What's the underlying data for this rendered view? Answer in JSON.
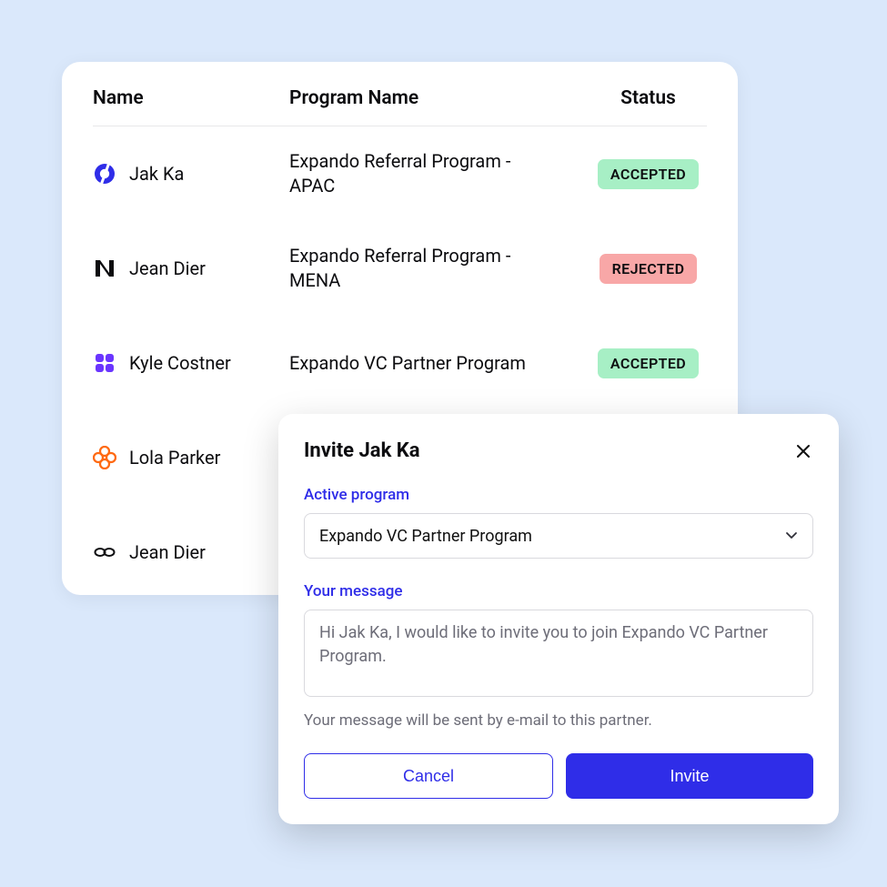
{
  "table": {
    "headers": {
      "name": "Name",
      "program": "Program Name",
      "status": "Status"
    },
    "rows": [
      {
        "icon": "circle-icon",
        "name": "Jak Ka",
        "program": "Expando Referral Program - APAC",
        "status": "ACCEPTED",
        "statusKind": "accepted"
      },
      {
        "icon": "n-icon",
        "name": "Jean Dier",
        "program": "Expando Referral Program - MENA",
        "status": "REJECTED",
        "statusKind": "rejected"
      },
      {
        "icon": "squares-icon",
        "name": "Kyle Costner",
        "program": "Expando VC Partner Program",
        "status": "ACCEPTED",
        "statusKind": "accepted"
      },
      {
        "icon": "flower-icon",
        "name": "Lola Parker",
        "program": "",
        "status": "",
        "statusKind": ""
      },
      {
        "icon": "links-icon",
        "name": "Jean Dier",
        "program": "",
        "status": "",
        "statusKind": ""
      }
    ]
  },
  "modal": {
    "title": "Invite Jak Ka",
    "program_label": "Active program",
    "program_value": "Expando VC Partner Program",
    "message_label": "Your message",
    "message_value": "Hi Jak Ka, I would like to invite you to join Expando VC Partner Program.",
    "hint": "Your message will be sent by e-mail to this partner.",
    "cancel": "Cancel",
    "invite": "Invite"
  }
}
